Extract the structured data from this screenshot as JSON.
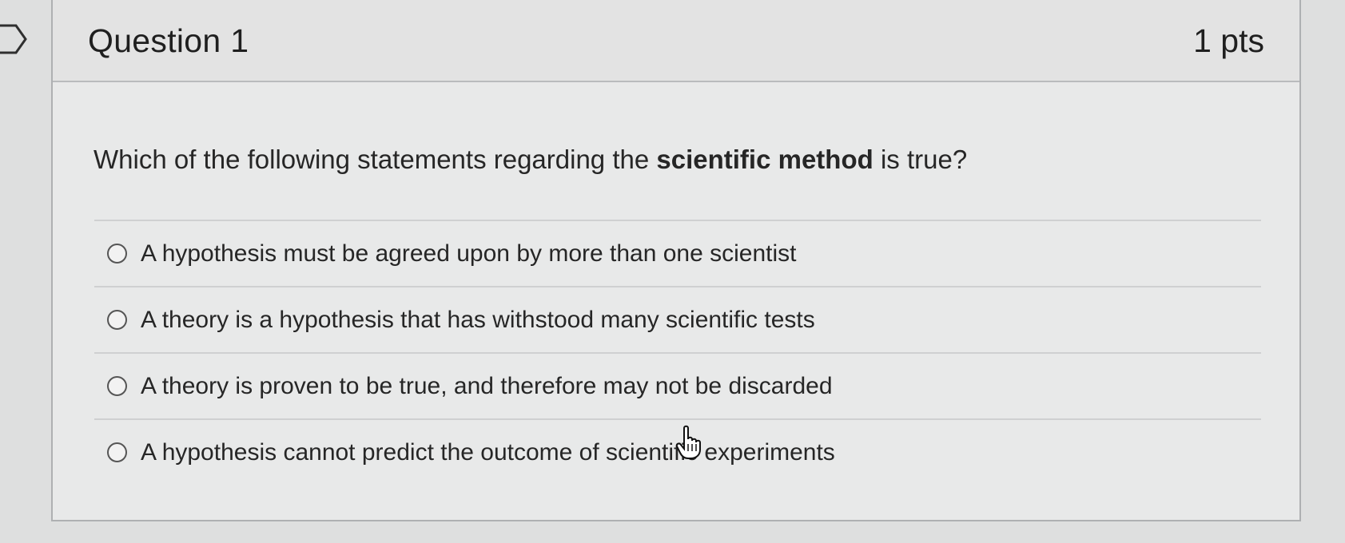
{
  "question": {
    "title": "Question 1",
    "points": "1 pts",
    "text_before": "Which of the following statements regarding the ",
    "text_bold": "scientific method",
    "text_after": " is true?"
  },
  "answers": [
    "A hypothesis must be agreed upon by more than one scientist",
    "A theory is a hypothesis that has withstood many scientific tests",
    "A theory is proven to be true, and therefore may not be discarded",
    "A hypothesis cannot predict the outcome of scientific experiments"
  ],
  "icons": {
    "flag": "flag-marker-icon",
    "cursor": "hand-pointer-cursor-icon",
    "radio": "radio-button-icon"
  }
}
